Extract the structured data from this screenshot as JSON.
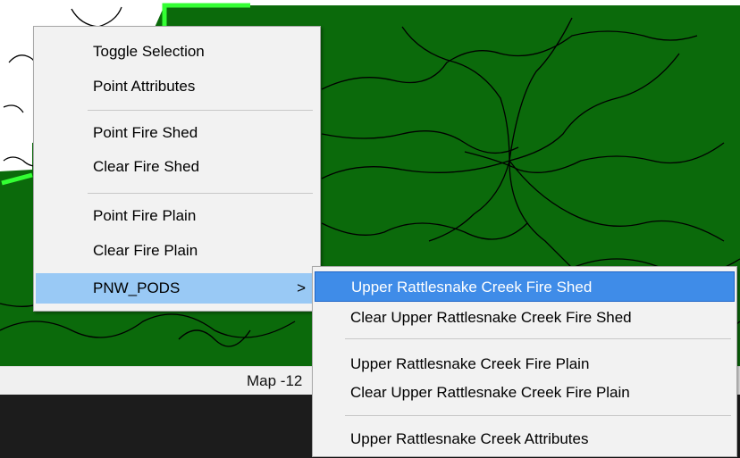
{
  "colors": {
    "map_fill": "#0b6a0b",
    "map_boundary": "#000000",
    "selection_highlight": "#33ff33",
    "menu_bg": "#f2f2f2",
    "menu_hover": "#99c9f5",
    "menu_selected": "#3f8ce8"
  },
  "status": {
    "text": "Map -12"
  },
  "menu": {
    "items": [
      {
        "label": "Toggle Selection"
      },
      {
        "label": "Point Attributes"
      },
      {
        "label": "Point Fire Shed"
      },
      {
        "label": "Clear Fire Shed"
      },
      {
        "label": "Point Fire Plain"
      },
      {
        "label": "Clear Fire Plain"
      },
      {
        "label": "PNW_PODS",
        "submenu_arrow": ">"
      }
    ]
  },
  "submenu": {
    "items": [
      {
        "label": "Upper Rattlesnake Creek Fire Shed"
      },
      {
        "label": "Clear Upper Rattlesnake Creek Fire Shed"
      },
      {
        "label": "Upper Rattlesnake Creek Fire Plain"
      },
      {
        "label": "Clear Upper Rattlesnake Creek Fire Plain"
      },
      {
        "label": "Upper Rattlesnake Creek Attributes"
      }
    ]
  }
}
